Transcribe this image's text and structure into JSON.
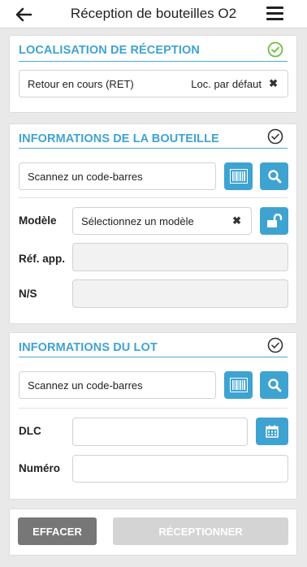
{
  "header": {
    "title": "Réception de bouteilles O2"
  },
  "location": {
    "title": "LOCALISATION DE RÉCEPTION",
    "value": "Retour en cours (RET)",
    "default_label": "Loc. par défaut",
    "clear_symbol": "✖",
    "status_color": "#6cbd45"
  },
  "bottle": {
    "title": "INFORMATIONS DE LA BOUTEILLE",
    "barcode_placeholder": "Scannez un code-barres",
    "model_label": "Modèle",
    "model_value": "Sélectionnez un modèle",
    "clear_symbol": "✖",
    "ref_label": "Réf. app.",
    "ref_value": "",
    "serial_label": "N/S",
    "serial_value": ""
  },
  "lot": {
    "title": "INFORMATIONS DU LOT",
    "barcode_placeholder": "Scannez un code-barres",
    "dlc_label": "DLC",
    "dlc_value": "",
    "number_label": "Numéro",
    "number_value": ""
  },
  "actions": {
    "clear_label": "EFFACER",
    "receive_label": "RÉCEPTIONNER"
  },
  "colors": {
    "accent": "#3fa3d1",
    "success": "#6cbd45",
    "clear_button": "#777777",
    "disabled_button": "#d4d4d4"
  },
  "icons": {
    "back": "arrow-left-icon",
    "menu": "hamburger-icon",
    "barcode": "barcode-icon",
    "search": "search-icon",
    "unlock": "unlock-icon",
    "calendar": "calendar-icon",
    "check": "check-circle-icon"
  }
}
